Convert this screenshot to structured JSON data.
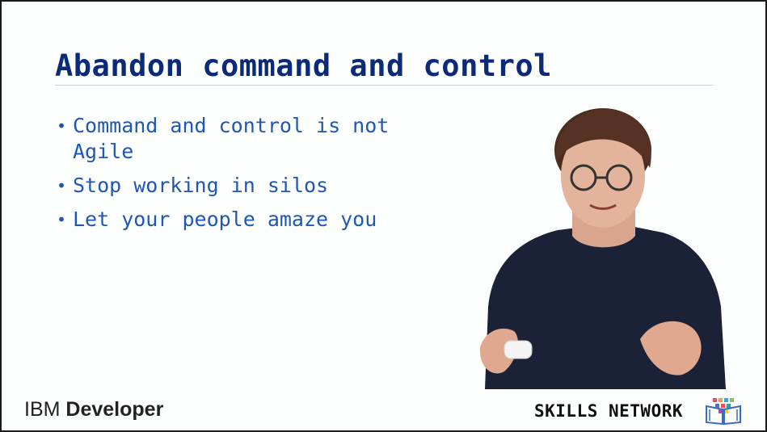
{
  "slide": {
    "title": "Abandon command and control",
    "bullets": [
      "Command and control is not Agile",
      "Stop working in silos",
      "Let your people amaze you"
    ]
  },
  "footer": {
    "left_brand_ibm": "IBM",
    "left_brand_developer": "Developer",
    "right_brand": "SKILLS NETWORK",
    "right_icon": "skills-network-book-icon"
  },
  "colors": {
    "title": "#0b2a78",
    "bullets": "#1f57b4",
    "rule": "#c8cfdc"
  }
}
